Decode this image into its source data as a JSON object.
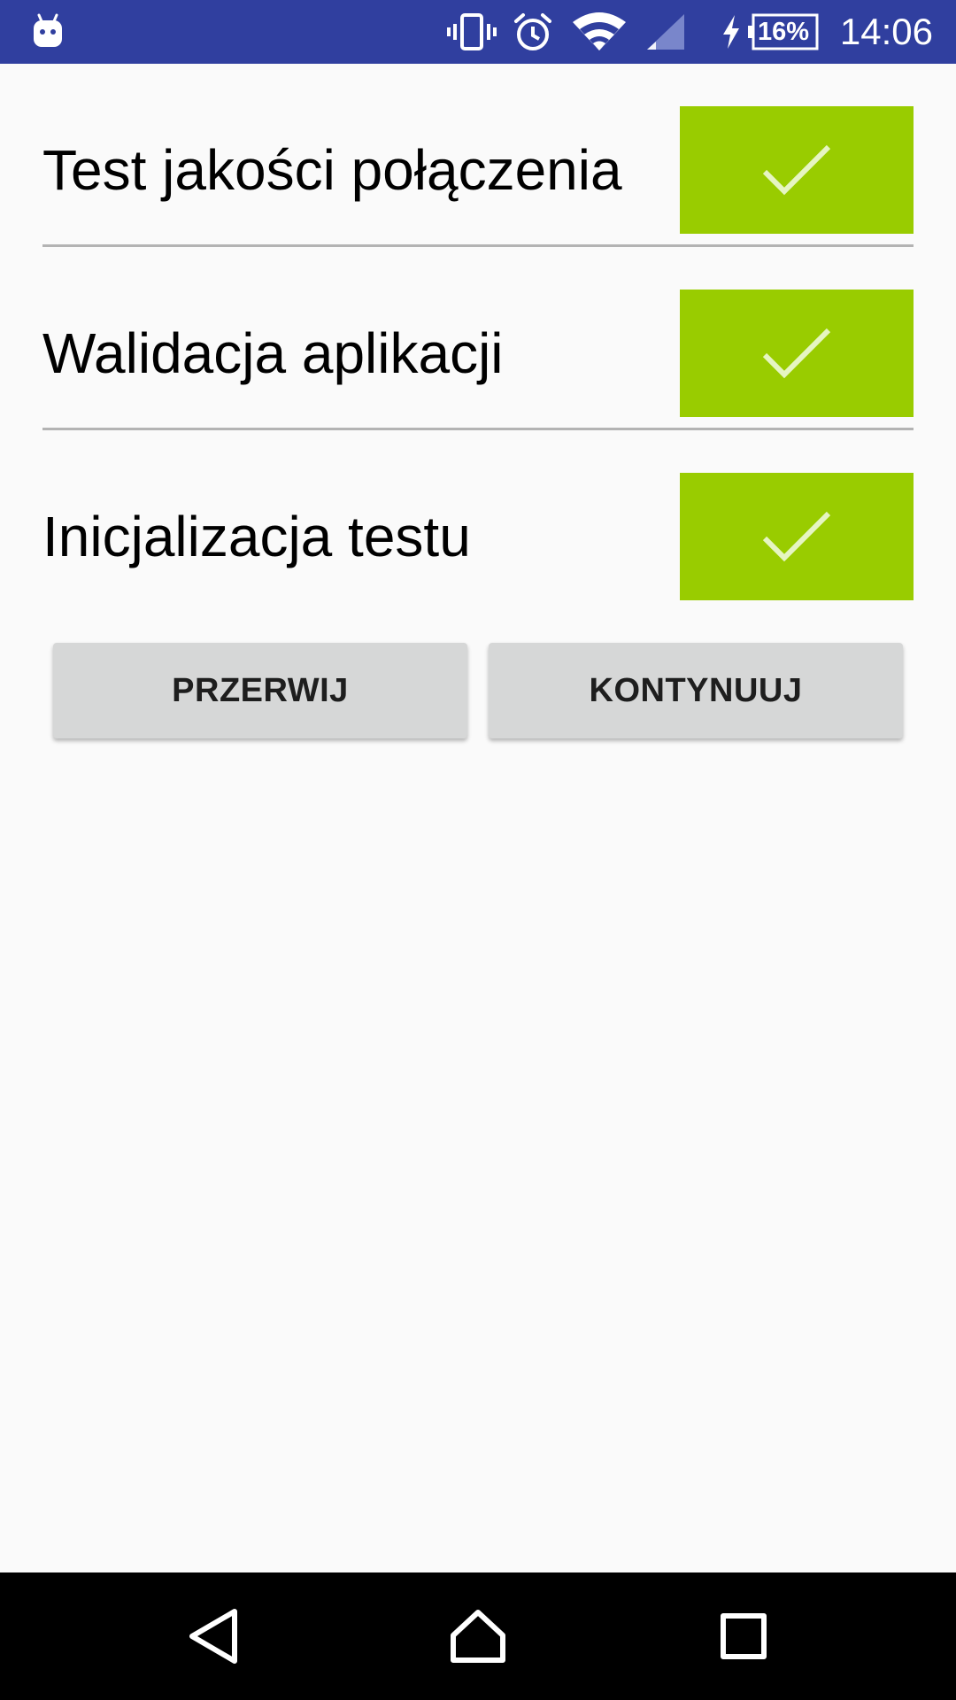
{
  "status_bar": {
    "time": "14:06",
    "battery_percent": "16%",
    "icons": [
      "android-icon",
      "vibrate-icon",
      "alarm-icon",
      "wifi-icon",
      "cell-signal-icon",
      "charging-icon",
      "battery-icon"
    ],
    "background_color": "#303f9f"
  },
  "checks": [
    {
      "label": "Test jakości połączenia",
      "status": "passed",
      "icon": "checkmark-icon"
    },
    {
      "label": "Walidacja aplikacji",
      "status": "passed",
      "icon": "checkmark-icon"
    },
    {
      "label": "Inicjalizacja testu",
      "status": "passed",
      "icon": "checkmark-icon"
    }
  ],
  "status_color": "#99cc00",
  "buttons": {
    "abort_label": "PRZERWIJ",
    "continue_label": "KONTYNUUJ"
  },
  "nav_bar": {
    "icons": [
      "back-icon",
      "home-icon",
      "recents-icon"
    ]
  }
}
